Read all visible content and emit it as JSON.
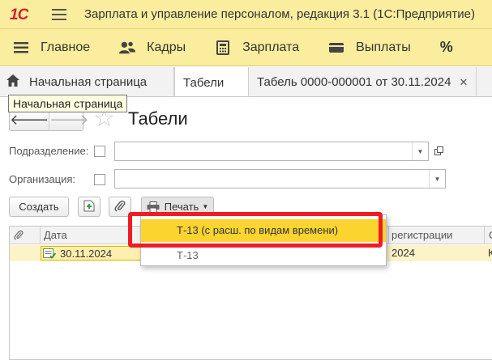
{
  "window": {
    "title": "Зарплата и управление персоналом, редакция 3.1  (1С:Предприятие)",
    "logo_text": "1С"
  },
  "sections": [
    {
      "label": "Главное",
      "icon": "menu-lines-icon"
    },
    {
      "label": "Кадры",
      "icon": "people-icon"
    },
    {
      "label": "Зарплата",
      "icon": "calculator-icon"
    },
    {
      "label": "Выплаты",
      "icon": "wallet-icon"
    },
    {
      "label": "%",
      "icon": "percent-icon"
    }
  ],
  "tabs": {
    "home": "Начальная страница",
    "active": "Табели",
    "document": "Табель 0000-000001 от 30.11.2024",
    "close_glyph": "✕"
  },
  "tooltip": "Начальная страница",
  "form": {
    "title": "Табели",
    "back": "🡐",
    "forward": "🡒",
    "star": "☆"
  },
  "filters": {
    "division_label": "Подразделение:",
    "organization_label": "Организация:",
    "division_value": "",
    "organization_value": ""
  },
  "toolbar": {
    "create": "Создать",
    "print": "Печать"
  },
  "grid": {
    "columns": {
      "date": "Дата",
      "registration": "регистрации",
      "extra": "С"
    },
    "rows": [
      {
        "date": "30.11.2024",
        "registration": "2024",
        "extra": "К"
      }
    ]
  },
  "print_menu": {
    "items": [
      "Т-13 (с расш. по видам времени)",
      "Т-13"
    ],
    "highlighted_index": 0
  },
  "colors": {
    "header_bg": "#fbed9e",
    "highlight": "#fbd430",
    "annotation_frame": "#ee1c25",
    "row_selected": "#fcf3c8"
  }
}
